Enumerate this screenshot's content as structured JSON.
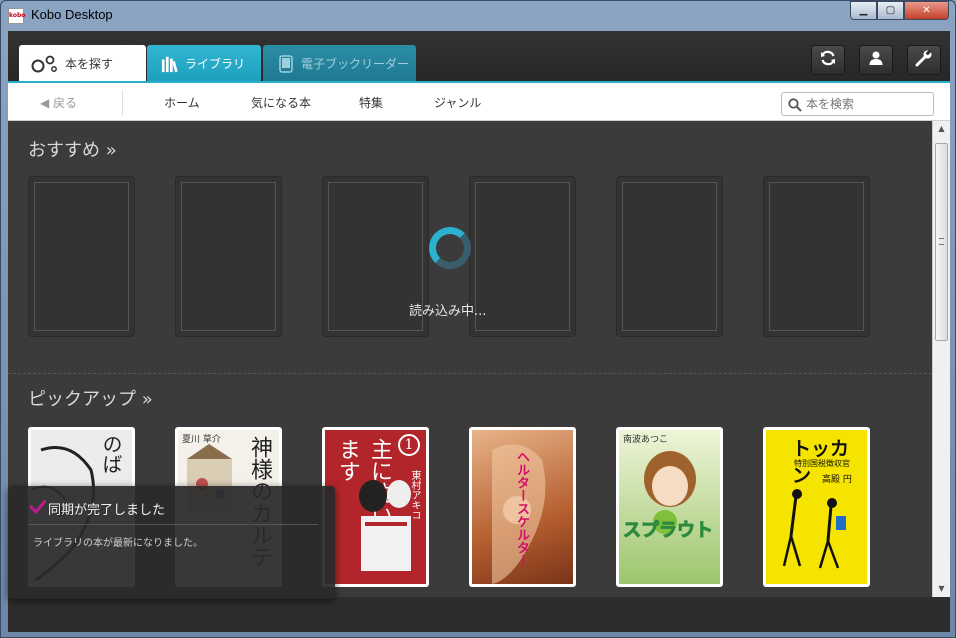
{
  "window": {
    "title": "Kobo Desktop",
    "logo_text": "kobo",
    "minimize": "▁",
    "maximize": "▢",
    "close": "✕"
  },
  "tabs": [
    {
      "label": "本を探す",
      "icon": "discover-icon"
    },
    {
      "label": "ライブラリ",
      "icon": "library-icon"
    },
    {
      "label": "電子ブックリーダー",
      "icon": "ereader-icon"
    }
  ],
  "toolbar": {
    "sync_icon": "sync-icon",
    "account_icon": "user-icon",
    "settings_icon": "wrench-icon"
  },
  "nav": {
    "back": "◀ 戻る",
    "links": [
      "ホーム",
      "気になる本",
      "特集",
      "ジャンル"
    ],
    "search_placeholder": "本を検索"
  },
  "sections": {
    "recommended": "おすすめ »",
    "loading": "読み込み中...",
    "pickup": "ピックアップ »"
  },
  "books": [
    {
      "text": "のば",
      "bg": "#e9e9e9"
    },
    {
      "text": "神様のカルテ",
      "author": "夏川 草介",
      "bg": "#f4f1ea"
    },
    {
      "text": "主に泣いてます",
      "author": "東村アキコ",
      "number": "1",
      "bg": "#b2262b"
    },
    {
      "text": "ヘルタースケルター",
      "bg": "#c77c4a"
    },
    {
      "text": "スプラウト",
      "author": "南波あつこ",
      "bg": "#9cc56d"
    },
    {
      "text": "トッカン",
      "subtitle": "特別国税徴収官",
      "author": "高殿 円",
      "bg": "#f5e400"
    }
  ],
  "toast": {
    "title": "同期が完了しました",
    "body": "ライブラリの本が最新になりました。"
  },
  "colors": {
    "accent": "#2aaecd",
    "check": "#c0188e"
  }
}
